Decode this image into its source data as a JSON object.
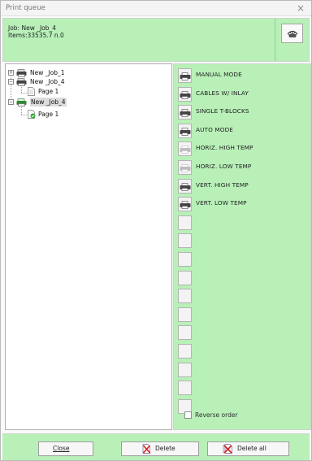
{
  "window": {
    "title": "Print queue",
    "close_glyph": "×"
  },
  "header": {
    "job_line": "Job: New _Job_4",
    "items_line": "Items:33535.7 n.0",
    "print_button_icon": "printer-eye-icon"
  },
  "tree": {
    "nodes": [
      {
        "label": "New _Job_1",
        "icon": "printer-job-icon",
        "expander": "+"
      },
      {
        "label": "New _Job_4",
        "icon": "printer-job-icon",
        "expander": "−"
      },
      {
        "label": "Page 1",
        "icon": "page-icon"
      },
      {
        "label": "New _Job_4",
        "icon": "printer-job-green-icon",
        "expander": "−"
      },
      {
        "label": "Page 1",
        "icon": "page-check-icon"
      }
    ]
  },
  "slots": [
    {
      "label": "MANUAL MODE",
      "icon": "printer-small-icon",
      "enabled": true
    },
    {
      "label": "CABLES W/ INLAY",
      "icon": "printer-small-icon",
      "enabled": true
    },
    {
      "label": "SINGLE T-BLOCKS",
      "icon": "printer-small-icon",
      "enabled": true
    },
    {
      "label": "AUTO MODE",
      "icon": "printer-small-icon",
      "enabled": true
    },
    {
      "label": "HORIZ. HIGH TEMP",
      "icon": "printer-small-icon",
      "enabled": false
    },
    {
      "label": "HORIZ. LOW TEMP",
      "icon": "printer-small-icon",
      "enabled": false
    },
    {
      "label": "VERT. HIGH TEMP",
      "icon": "printer-small-icon",
      "enabled": true
    },
    {
      "label": "VERT. LOW TEMP",
      "icon": "printer-small-icon",
      "enabled": true
    },
    {
      "label": "",
      "enabled": true
    },
    {
      "label": "",
      "enabled": true
    },
    {
      "label": "",
      "enabled": true
    },
    {
      "label": "",
      "enabled": true
    },
    {
      "label": "",
      "enabled": true
    },
    {
      "label": "",
      "enabled": true
    },
    {
      "label": "",
      "enabled": true
    },
    {
      "label": "",
      "enabled": true
    },
    {
      "label": "",
      "enabled": true
    },
    {
      "label": "",
      "enabled": true
    },
    {
      "label": "",
      "enabled": true
    }
  ],
  "reverse_order": {
    "label": "Reverse order",
    "checked": false
  },
  "footer": {
    "close_label": "Close",
    "delete_label": "Delete",
    "delete_all_label": "Delete all",
    "delete_icon": "delete-page-icon",
    "delete_all_icon": "delete-all-pages-icon"
  },
  "colors": {
    "panel_green": "#b8f0b8",
    "delete_red": "#d42020"
  }
}
